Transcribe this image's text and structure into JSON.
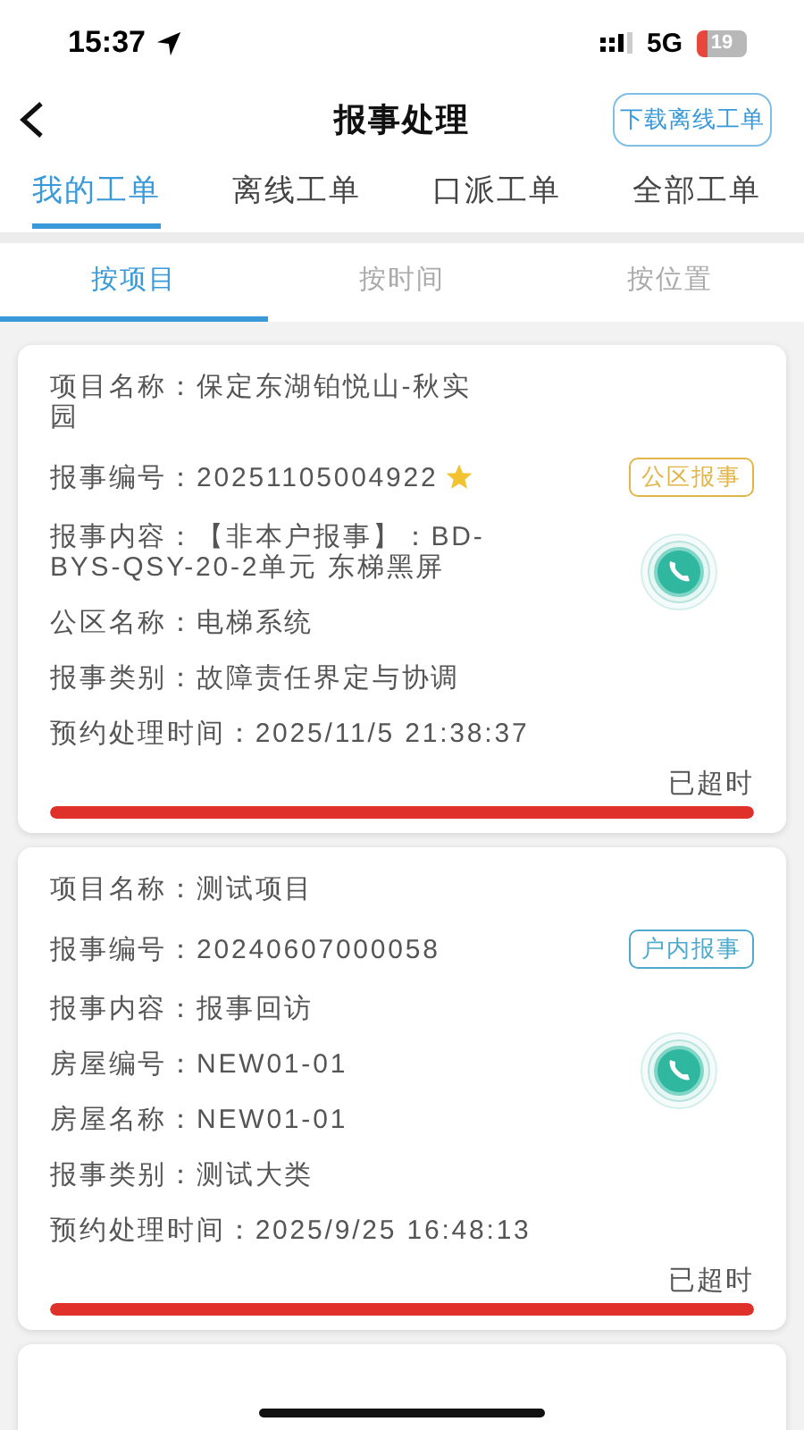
{
  "status_bar": {
    "time": "15:37",
    "network": "5G",
    "battery": "19"
  },
  "nav": {
    "title": "报事处理",
    "action": "下载离线工单"
  },
  "tabs": [
    {
      "label": "我的工单",
      "selected": true
    },
    {
      "label": "离线工单",
      "selected": false
    },
    {
      "label": "口派工单",
      "selected": false
    },
    {
      "label": "全部工单",
      "selected": false
    }
  ],
  "sub_tabs": [
    {
      "label": "按项目",
      "selected": true
    },
    {
      "label": "按时间",
      "selected": false
    },
    {
      "label": "按位置",
      "selected": false
    }
  ],
  "cards": [
    {
      "fields": [
        {
          "kind": "text",
          "label": "项目名称：",
          "value": "保定东湖铂悦山-秋实园"
        },
        {
          "kind": "number",
          "label": "报事编号：",
          "value": "20251105004922",
          "starred": true
        },
        {
          "kind": "text",
          "label": "报事内容：",
          "value": "【非本户报事】：BD-BYS-QSY-20-2单元  东梯黑屏"
        },
        {
          "kind": "text",
          "label": "公区名称：",
          "value": "电梯系统"
        },
        {
          "kind": "text",
          "label": "报事类别：",
          "value": "故障责任界定与协调"
        },
        {
          "kind": "time",
          "label": "预约处理时间：",
          "value": "2025/11/5 21:38:37"
        }
      ],
      "tag": {
        "label": "公区报事",
        "color": "#e2b54a"
      },
      "status": "已超时",
      "level": 1
    },
    {
      "fields": [
        {
          "kind": "text",
          "label": "项目名称：",
          "value": "测试项目"
        },
        {
          "kind": "number",
          "label": "报事编号：",
          "value": "20240607000058",
          "starred": false
        },
        {
          "kind": "text",
          "label": "报事内容：",
          "value": "报事回访"
        },
        {
          "kind": "text",
          "label": "房屋编号：",
          "value": "NEW01-01"
        },
        {
          "kind": "text",
          "label": "房屋名称：",
          "value": "NEW01-01"
        },
        {
          "kind": "text",
          "label": "报事类别：",
          "value": "测试大类"
        },
        {
          "kind": "time",
          "label": "预约处理时间：",
          "value": "2025/9/25 16:48:13"
        }
      ],
      "tag": {
        "label": "户内报事",
        "color": "#4ea9cc"
      },
      "status": "已超时",
      "level": 1
    },
    {
      "kind": "placeholder"
    }
  ]
}
